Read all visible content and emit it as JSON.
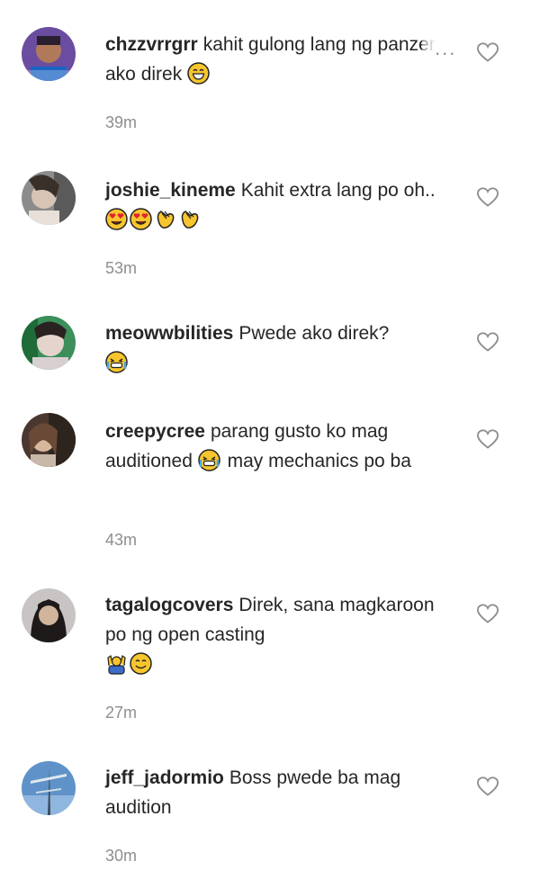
{
  "comments": [
    {
      "username": "chzzvrrgrr",
      "text": "kahit gulong lang ng panzer ako direk",
      "emojis": [
        "grin-face"
      ],
      "time": "39m"
    },
    {
      "username": "joshie_kineme",
      "text": "Kahit extra lang po oh..",
      "emojis": [
        "heart-eyes-face",
        "heart-eyes-face",
        "clapping-hands",
        "clapping-hands"
      ],
      "time": "53m"
    },
    {
      "username": "meowwbilities",
      "text": "Pwede ako direk?",
      "emojis": [
        "grimacing-tears-face"
      ],
      "time": ""
    },
    {
      "username": "creepycree",
      "text_before": "parang gusto ko mag auditioned",
      "text_after": "may mechanics po ba",
      "emojis": [
        "grimacing-tears-face"
      ],
      "time": "43m"
    },
    {
      "username": "tagalogcovers",
      "text": "Direk, sana magkaroon po ng open casting",
      "emojis": [
        "person-raising-hands",
        "smiling-face"
      ],
      "time": "27m"
    },
    {
      "username": "jeff_jadormio",
      "text": "Boss pwede ba mag audition",
      "emojis": [],
      "time": "30m"
    }
  ],
  "more_label": "...",
  "colors": {
    "text": "#262626",
    "meta": "#8e8e8e",
    "heart_stroke": "#8e8e8e",
    "emoji_yellow": "#f7c52d"
  },
  "icons": {
    "like": "heart-outline-icon",
    "more": "more-options-icon"
  }
}
